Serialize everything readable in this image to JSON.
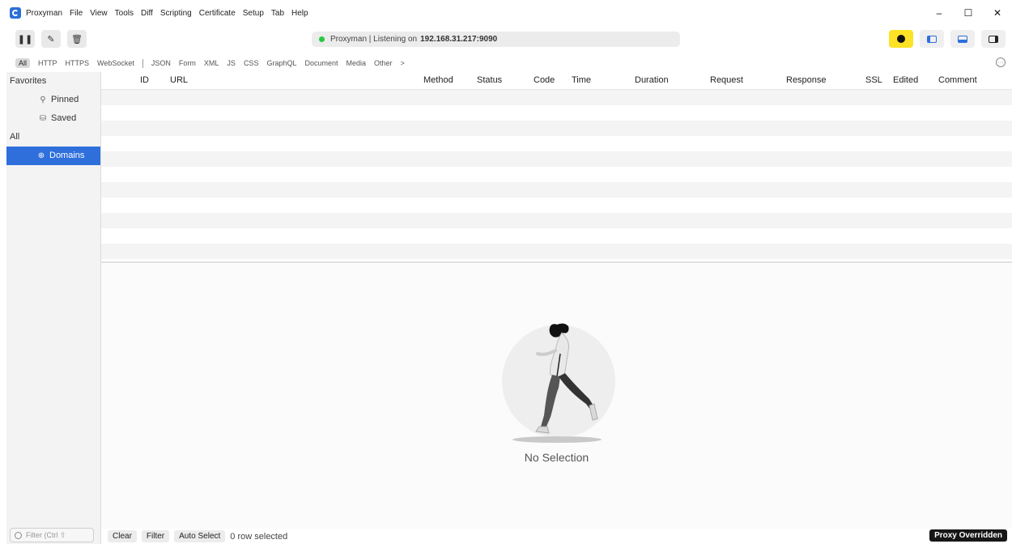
{
  "titlebar": {
    "menu": [
      "Proxyman",
      "File",
      "View",
      "Tools",
      "Diff",
      "Scripting",
      "Certificate",
      "Setup",
      "Tab",
      "Help"
    ],
    "controls": {
      "minimize": "–",
      "maximize": "☐",
      "close": "✕"
    }
  },
  "toolbar": {
    "pause_icon": "❚❚",
    "compose_icon": "✎",
    "trash_icon": "🗑",
    "status_prefix": "Proxyman | Listening on",
    "status_address": "192.168.31.217:9090",
    "status_color": "#28c840",
    "alert_color": "#fde225"
  },
  "filterbar": {
    "group1": [
      "All",
      "HTTP",
      "HTTPS",
      "WebSocket"
    ],
    "group2": [
      "JSON",
      "Form",
      "XML",
      "JS",
      "CSS",
      "GraphQL",
      "Document",
      "Media",
      "Other",
      ">"
    ],
    "more_icon": "···"
  },
  "sidebar": {
    "favorites_label": "Favorites",
    "pinned": {
      "icon": "⚲",
      "label": "Pinned"
    },
    "saved": {
      "icon": "⛁",
      "label": "Saved"
    },
    "all_label": "All",
    "domains": {
      "icon": "⊕",
      "label": "Domains"
    },
    "filter_placeholder": "Filter (Ctrl ⇧"
  },
  "table": {
    "columns": [
      "ID",
      "URL",
      "Method",
      "Status",
      "Code",
      "Time",
      "Duration",
      "Request",
      "Response",
      "SSL",
      "Edited",
      "Comment"
    ]
  },
  "detail": {
    "empty_text": "No Selection"
  },
  "bottombar": {
    "clear": "Clear",
    "filter": "Filter",
    "auto_select": "Auto Select",
    "row_count": "0 row selected",
    "proxy_badge": "Proxy Overridden"
  },
  "colors": {
    "accent": "#2f6fdc"
  }
}
